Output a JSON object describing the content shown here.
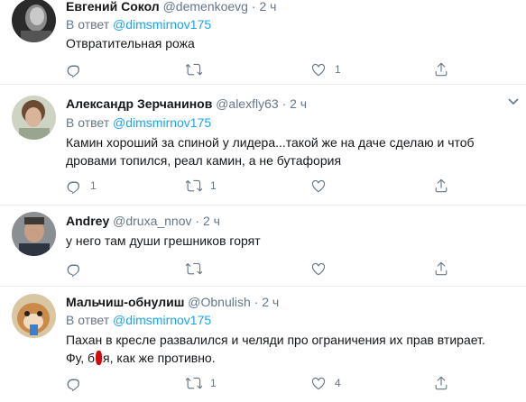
{
  "tweets": [
    {
      "name": "Евгений Сокол",
      "handle": "@demenkoevg",
      "dot": "·",
      "time": "2 ч",
      "reply_prefix": "В ответ",
      "reply_to": "@dimsmirnov175",
      "lines": [
        "Отвратительная рожа"
      ],
      "reply_count": "",
      "retweet_count": "",
      "like_count": "1"
    },
    {
      "name": "Александр Зерчанинов",
      "handle": "@alexfly63",
      "dot": "·",
      "time": "2 ч",
      "reply_prefix": "В ответ",
      "reply_to": "@dimsmirnov175",
      "lines": [
        "Камин хороший за спиной у лидера...такой же на даче сделаю и чтоб",
        "дровами топился, реал камин, а не бутафория"
      ],
      "reply_count": "1",
      "retweet_count": "1",
      "like_count": ""
    },
    {
      "name": "Andrey",
      "handle": "@druxa_nnov",
      "dot": "·",
      "time": "2 ч",
      "lines": [
        "у него там души грешников горят"
      ],
      "reply_count": "",
      "retweet_count": "",
      "like_count": ""
    },
    {
      "name": "Мальчиш-обнулиш",
      "handle": "@Obnulish",
      "dot": "·",
      "time": "2 ч",
      "reply_prefix": "В ответ",
      "reply_to": "@dimsmirnov175",
      "lines": [
        "Пахан в кресле развалился и челяди про ограничения их прав втирает."
      ],
      "line2_before": "Фу, б",
      "line2_after": "я, как же противно.",
      "reply_count": "",
      "retweet_count": "1",
      "like_count": "4"
    }
  ],
  "icons": {
    "reply": "reply-icon",
    "retweet": "retweet-icon",
    "like": "like-icon",
    "share": "share-icon",
    "caret": "chevron-down-icon"
  },
  "colors": {
    "link": "#1da1f2",
    "secondary": "#657786",
    "text": "#14171a",
    "divider": "#e6ecf0",
    "censor": "#d10b0b"
  }
}
